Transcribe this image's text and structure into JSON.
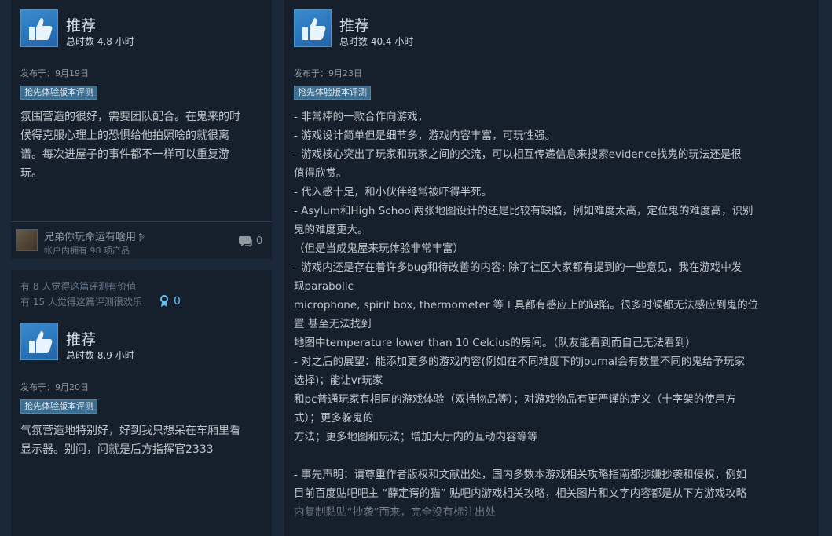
{
  "reviews": [
    {
      "recommendation": "推荐",
      "hours": "总时数 4.8 小时",
      "posted": "发布于：9月19日",
      "badge": "抢先体验版本评测",
      "text": "氛围营造的很好，需要团队配合。在鬼来的时\n候得克服心理上的恐惧给他拍照啥的就很离\n谱。每次进屋子的事件都不一样可以重复游\n玩。",
      "author": {
        "name": "兄弟你玩命运有啥用𝥁",
        "sub": "帐户内拥有 98 项产品"
      },
      "comments": "0"
    },
    {
      "helpful_1": "有 8 人觉得这篇评测有价值",
      "helpful_2": "有 15 人觉得这篇评测很欢乐",
      "awards": "0",
      "recommendation": "推荐",
      "hours": "总时数 8.9 小时",
      "posted": "发布于：9月20日",
      "badge": "抢先体验版本评测",
      "text": "气氛营造地特别好，好到我只想呆在车厢里看\n显示器。别问，问就是后方指挥官2333"
    },
    {
      "recommendation": "推荐",
      "hours": "总时数 40.4 小时",
      "posted": "发布于：9月23日",
      "badge": "抢先体验版本评测",
      "text": "- 非常棒的一款合作向游戏，\n- 游戏设计简单但是细节多，游戏内容丰富，可玩性强。\n- 游戏核心突出了玩家和玩家之间的交流，可以相互传递信息来搜索evidence找鬼的玩法还是很\n值得欣赏。\n- 代入感十足，和小伙伴经常被吓得半死。\n- Asylum和High School两张地图设计的还是比较有缺陷，例如难度太高，定位鬼的难度高，识别\n鬼的难度更大。\n（但是当成鬼屋来玩体验非常丰富）\n- 游戏内还是存在着许多bug和待改善的内容: 除了社区大家都有提到的一些意见，我在游戏中发\n现parabolic\nmicrophone, spirit box, thermometer 等工具都有感应上的缺陷。很多时候都无法感应到鬼的位\n置 甚至无法找到\n地图中temperature lower than 10 Celcius的房间。（队友能看到而自己无法看到）\n- 对之后的展望：能添加更多的游戏内容(例如在不同难度下的journal会有数量不同的鬼给予玩家\n选择)；能让vr玩家\n和pc普通玩家有相同的游戏体验（双持物品等）；对游戏物品有更严谨的定义（十字架的使用方\n式）；更多躲鬼的\n方法；更多地图和玩法；增加大厅内的互动内容等等\n\n- 事先声明：请尊重作者版权和文献出处，国内多数本游戏相关攻略指南都涉嫌抄袭和侵权，例如\n目前百度贴吧吧主 “薛定谔的猫” 贴吧内游戏相关攻略，相关图片和文字内容都是从下方游戏攻略\n内复制黏贴“抄袭”而来，完全没有标注出处"
    }
  ],
  "icons": {
    "thumb": "thumbs-up-icon",
    "comment": "comment-bubble-icon",
    "award": "award-ribbon-icon"
  },
  "colors": {
    "background": "#1b2838",
    "card": "#16202d",
    "badge": "#3d6c8d",
    "accent": "#66c0f4"
  }
}
